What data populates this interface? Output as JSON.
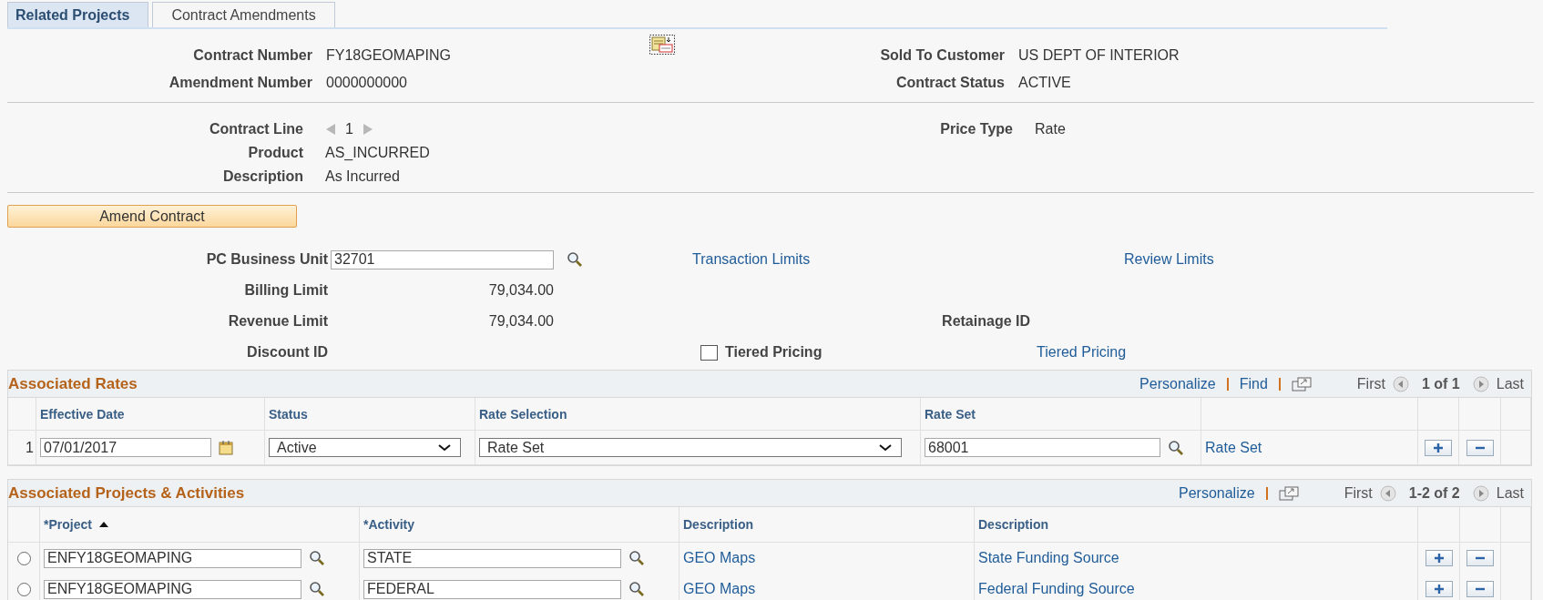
{
  "tabs": [
    {
      "label": "Related Projects",
      "selected": true
    },
    {
      "label": "Contract Amendments",
      "selected": false
    }
  ],
  "header": {
    "contract_number_label": "Contract Number",
    "contract_number": "FY18GEOMAPING",
    "amendment_number_label": "Amendment Number",
    "amendment_number": "0000000000",
    "sold_to_label": "Sold To Customer",
    "sold_to": "US DEPT OF INTERIOR",
    "status_label": "Contract Status",
    "status": "ACTIVE"
  },
  "line": {
    "contract_line_label": "Contract Line",
    "contract_line": "1",
    "price_type_label": "Price Type",
    "price_type": "Rate",
    "product_label": "Product",
    "product": "AS_INCURRED",
    "description_label": "Description",
    "description": "As Incurred"
  },
  "amend_button": "Amend Contract",
  "limits": {
    "business_unit_label": "PC Business Unit",
    "business_unit": "32701",
    "transaction_limits_link": "Transaction Limits",
    "review_limits_link": "Review Limits",
    "billing_limit_label": "Billing Limit",
    "billing_limit": "79,034.00",
    "revenue_limit_label": "Revenue Limit",
    "revenue_limit": "79,034.00",
    "retainage_label": "Retainage ID",
    "discount_label": "Discount ID",
    "tiered_pricing_label": "Tiered Pricing",
    "tiered_pricing_checked": false,
    "tiered_pricing_link": "Tiered Pricing"
  },
  "rates": {
    "title": "Associated Rates",
    "personalize": "Personalize",
    "find": "Find",
    "first": "First",
    "counter": "1 of 1",
    "last": "Last",
    "columns": [
      "Effective Date",
      "Status",
      "Rate Selection",
      "Rate Set"
    ],
    "rows": [
      {
        "number": "1",
        "effective_date": "07/01/2017",
        "status": "Active",
        "rate_selection": "Rate Set",
        "rate_set": "68001",
        "rate_set_link": "Rate Set"
      }
    ]
  },
  "projects": {
    "title": "Associated Projects & Activities",
    "personalize": "Personalize",
    "first": "First",
    "counter": "1-2 of 2",
    "last": "Last",
    "columns": [
      "*Project",
      "*Activity",
      "Description",
      "Description"
    ],
    "rows": [
      {
        "selected": false,
        "project": "ENFY18GEOMAPING",
        "activity": "STATE",
        "description": "GEO Maps",
        "funding": "State Funding Source"
      },
      {
        "selected": false,
        "project": "ENFY18GEOMAPING",
        "activity": "FEDERAL",
        "description": "GEO Maps",
        "funding": "Federal Funding Source"
      }
    ]
  }
}
